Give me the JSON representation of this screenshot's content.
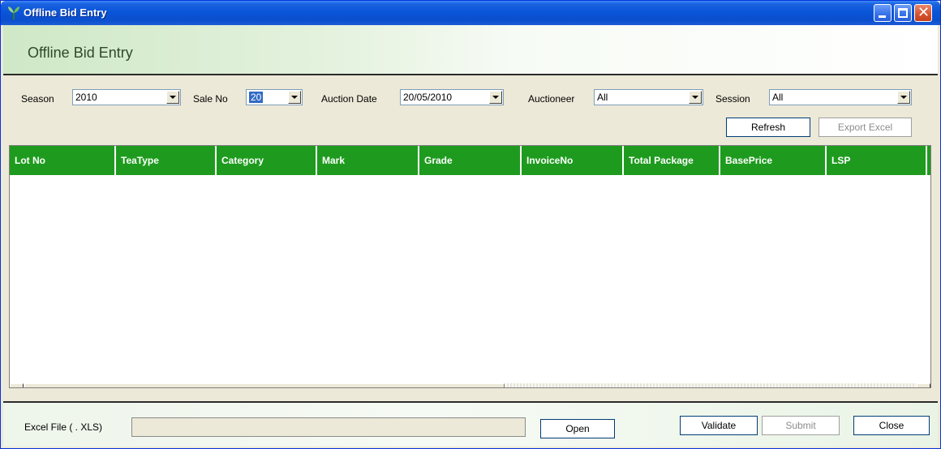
{
  "window": {
    "title": "Offline Bid Entry",
    "icons": {
      "app": "tea-leaf-logo-icon",
      "minimize": "minimize-icon",
      "maximize": "maximize-icon",
      "close": "close-x-icon"
    }
  },
  "header": {
    "title": "Offline Bid Entry"
  },
  "filters": {
    "season": {
      "label": "Season",
      "value": "2010"
    },
    "sale_no": {
      "label": "Sale No",
      "value": "20"
    },
    "auction_date": {
      "label": "Auction Date",
      "value": "20/05/2010"
    },
    "auctioneer": {
      "label": "Auctioneer",
      "value": "All"
    },
    "session": {
      "label": "Session",
      "value": "All"
    },
    "refresh_label": "Refresh",
    "export_label": "Export Excel"
  },
  "grid": {
    "columns": [
      "Lot No",
      "TeaType",
      "Category",
      "Mark",
      "Grade",
      "InvoiceNo",
      "Total Package",
      "BasePrice",
      "LSP"
    ],
    "rows": []
  },
  "bottom": {
    "file_label": "Excel File ( . XLS)",
    "file_value": "",
    "open_label": "Open",
    "validate_label": "Validate",
    "submit_label": "Submit",
    "close_label": "Close"
  },
  "colors": {
    "title_blue": "#0a55d8",
    "grid_header_green": "#1e9b1e",
    "window_bg": "#ece9d8"
  }
}
